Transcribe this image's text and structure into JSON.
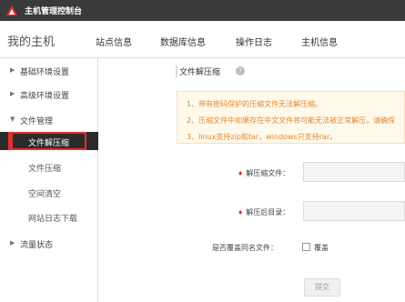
{
  "titlebar": {
    "app_title": "主机管理控制台"
  },
  "navbar": {
    "brand": "我的主机",
    "tabs": [
      {
        "label": "站点信息"
      },
      {
        "label": "数据库信息"
      },
      {
        "label": "操作日志"
      },
      {
        "label": "主机信息"
      }
    ]
  },
  "sidebar": {
    "groups": [
      {
        "label": "基础环境设置",
        "expanded": false
      },
      {
        "label": "高级环境设置",
        "expanded": false
      },
      {
        "label": "文件管理",
        "expanded": true
      },
      {
        "label": "流量状态",
        "expanded": false
      }
    ],
    "file_items": [
      {
        "label": "文件解压缩",
        "active": true
      },
      {
        "label": "文件压缩"
      },
      {
        "label": "空间清空"
      },
      {
        "label": "网站日志下载"
      }
    ]
  },
  "content": {
    "title": "文件解压缩",
    "notices": [
      "1、带有密码保护的压缩文件无法解压缩。",
      "2、压缩文件中如果存在中文文件将可能无法被正常解压，请确保",
      "3、linux支持zip和tar，windows只支持rar。"
    ],
    "form": {
      "archive_label": "解压缩文件：",
      "target_label": "解压后目录：",
      "overwrite_label": "是否覆盖同名文件：",
      "overwrite_option": "覆盖",
      "submit": "提交"
    }
  },
  "colors": {
    "accent": "#e0302f",
    "titlebar": "#3a3a3a",
    "notice_text": "#e08a2c"
  }
}
